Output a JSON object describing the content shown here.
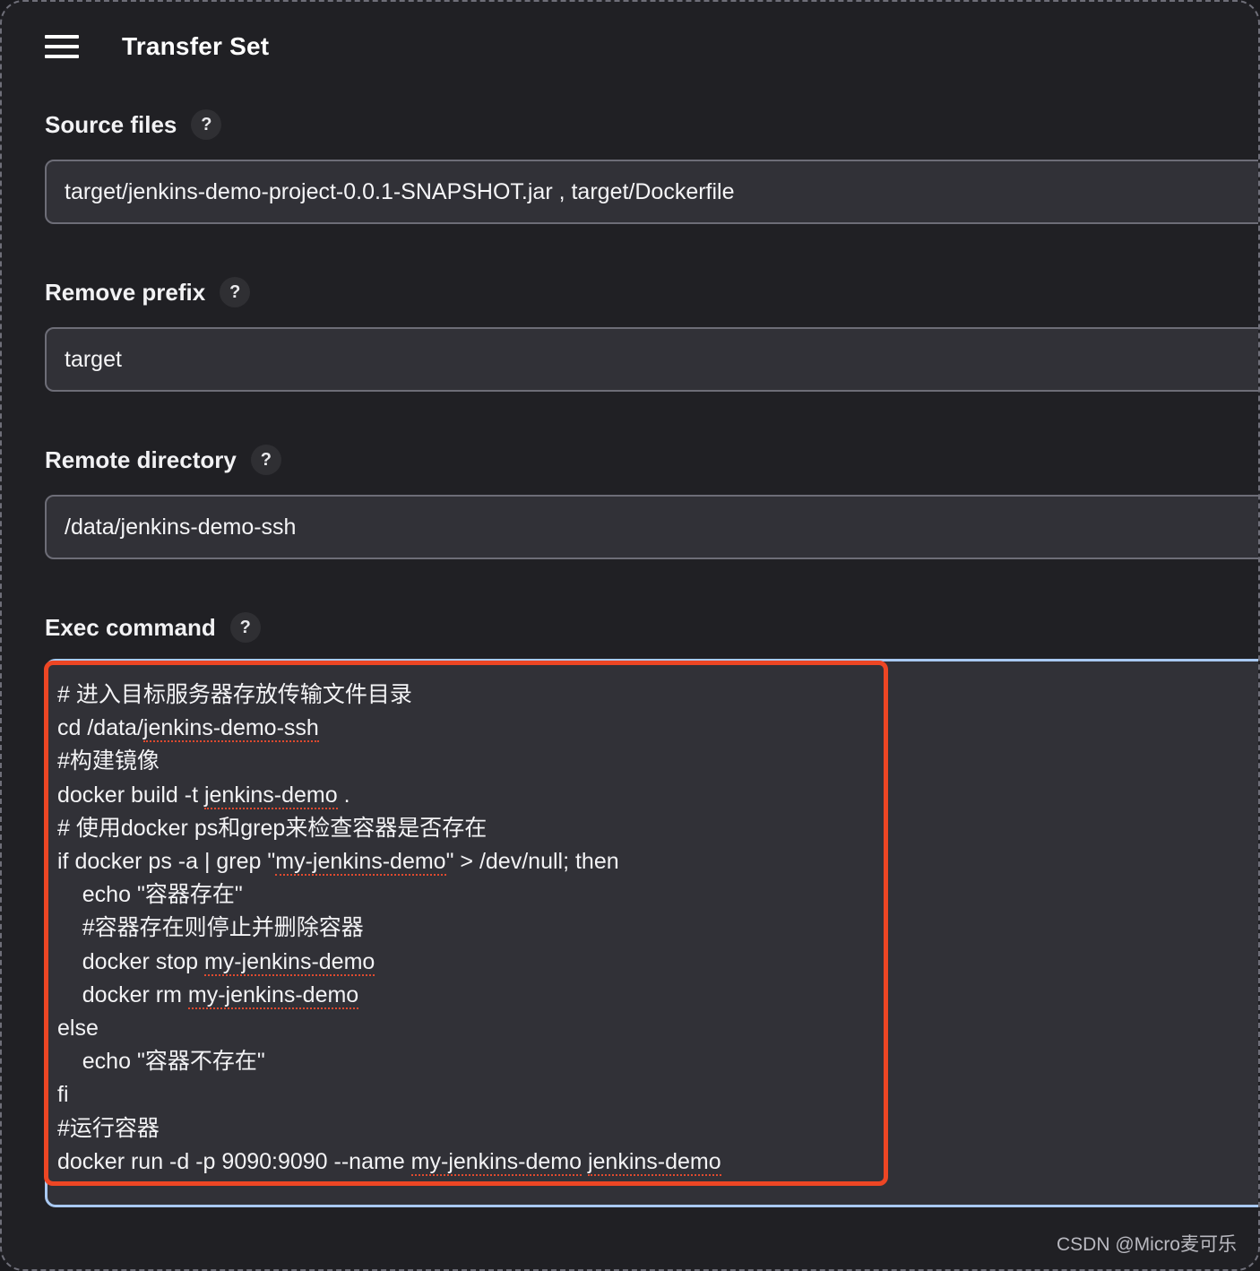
{
  "header": {
    "menu_icon": "hamburger-menu-icon",
    "title": "Transfer Set"
  },
  "help_icon_glyph": "?",
  "fields": [
    {
      "label": "Source files",
      "value": "target/jenkins-demo-project-0.0.1-SNAPSHOT.jar , target/Dockerfile",
      "placeholder": ""
    },
    {
      "label": "Remove prefix",
      "value": "target",
      "placeholder": ""
    },
    {
      "label": "Remote directory",
      "value": "/data/jenkins-demo-ssh",
      "placeholder": ""
    }
  ],
  "exec_command": {
    "label": "Exec command",
    "lines": [
      "# 进入目标服务器存放传输文件目录",
      "cd /data/jenkins-demo-ssh",
      "#构建镜像",
      "docker build -t jenkins-demo .",
      "# 使用docker ps和grep来检查容器是否存在",
      "if docker ps -a | grep \"my-jenkins-demo\" > /dev/null; then",
      "    echo \"容器存在\"",
      "    #容器存在则停止并删除容器",
      "    docker stop my-jenkins-demo",
      "    docker rm my-jenkins-demo",
      "else",
      "    echo \"容器不存在\"",
      "fi",
      "#运行容器",
      "docker run -d -p 9090:9090 --name my-jenkins-demo jenkins-demo"
    ],
    "value": "# 进入目标服务器存放传输文件目录\ncd /data/jenkins-demo-ssh\n#构建镜像\ndocker build -t jenkins-demo .\n# 使用docker ps和grep来检查容器是否存在\nif docker ps -a | grep \"my-jenkins-demo\" > /dev/null; then\n    echo \"容器存在\"\n    #容器存在则停止并删除容器\n    docker stop my-jenkins-demo\n    docker rm my-jenkins-demo\nelse\n    echo \"容器不存在\"\nfi\n#运行容器\ndocker run -d -p 9090:9090 --name my-jenkins-demo jenkins-demo"
  },
  "annotation": {
    "color": "#ed4624"
  },
  "colors": {
    "page_background": "#202024",
    "input_background": "#313137",
    "input_border": "#6d6d77",
    "focus_border": "#a9c9f2",
    "text": "#f3f3f5",
    "spellcheck_underline": "#e04a2f"
  },
  "watermark": "CSDN @Micro麦可乐"
}
